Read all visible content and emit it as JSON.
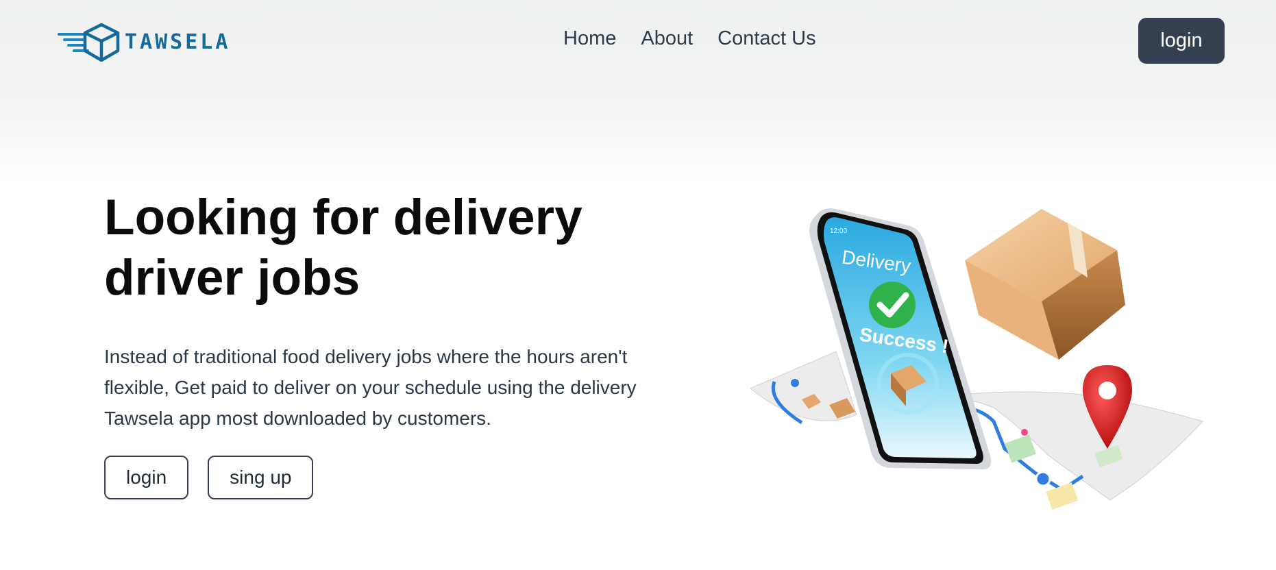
{
  "brand": {
    "name": "TAWSELA",
    "color": "#156a99"
  },
  "nav": {
    "items": [
      {
        "label": "Home"
      },
      {
        "label": "About"
      },
      {
        "label": "Contact Us"
      }
    ],
    "login_label": "login"
  },
  "hero": {
    "title": "Looking for delivery driver jobs",
    "text": "Instead of traditional food delivery jobs where the hours aren't flexible, Get paid to deliver on your schedule using the delivery Tawsela app most downloaded by customers.",
    "login_label": "login",
    "signup_label": "sing up"
  },
  "illustration": {
    "screen_title": "Delivery",
    "screen_status": "Success !",
    "status_time": "12:00"
  },
  "colors": {
    "primary_dark": "#34404f",
    "brand_blue": "#156a99"
  }
}
